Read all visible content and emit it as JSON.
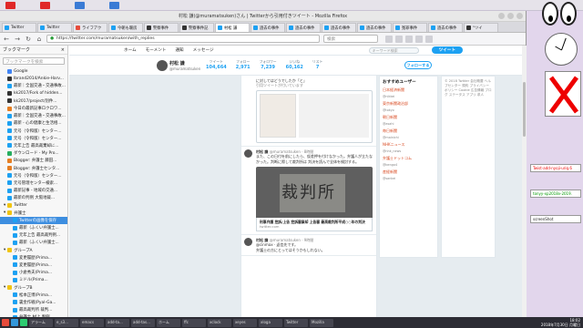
{
  "window": {
    "title": "村松 謙(@muramatsuken)さん | Twitterから引用付きツイート - Mozilla Firefox"
  },
  "tabs": [
    {
      "label": "Twitter",
      "color": "#1da1f2",
      "active": false
    },
    {
      "label": "Twitter",
      "color": "#1da1f2",
      "active": false
    },
    {
      "label": "ライフアク",
      "color": "#e74c3c",
      "active": false
    },
    {
      "label": "今朝も暖房",
      "color": "#1da1f2",
      "active": false
    },
    {
      "label": "警察事件",
      "color": "#333333",
      "active": false
    },
    {
      "label": "警察事件記",
      "color": "#333333",
      "active": false
    },
    {
      "label": "村松 謙",
      "color": "#1da1f2",
      "active": true
    },
    {
      "label": "過去の事件",
      "color": "#1da1f2",
      "active": false
    },
    {
      "label": "過去の事件",
      "color": "#1da1f2",
      "active": false
    },
    {
      "label": "過去の事件",
      "color": "#1da1f2",
      "active": false
    },
    {
      "label": "過去の事件",
      "color": "#1da1f2",
      "active": false
    },
    {
      "label": "冤罪事件",
      "color": "#1da1f2",
      "active": false
    },
    {
      "label": "過去の事件",
      "color": "#1da1f2",
      "active": false
    },
    {
      "label": "\"ツイ",
      "color": "#333333",
      "active": false
    }
  ],
  "navbar": {
    "url": "https://twitter.com/muramatsuken/with_replies",
    "search_placeholder": "検索"
  },
  "sidebar": {
    "title": "ブックマーク",
    "close": "×",
    "search_placeholder": "ブックマークを検索",
    "items": [
      {
        "label": "Google",
        "kind": "item",
        "color": "#4285f4"
      },
      {
        "label": "Ibrand2014/Ankie-Harv...",
        "kind": "item",
        "color": "#333333"
      },
      {
        "label": "最新｜全国交通・交通事故...",
        "kind": "item",
        "color": "#1da1f2"
      },
      {
        "label": "kk2017/Fork of hidden...",
        "kind": "item",
        "color": "#333333"
      },
      {
        "label": "kk2017/project/別件...",
        "kind": "item",
        "color": "#333333"
      },
      {
        "label": "今日の最新記事ロクロワ...",
        "kind": "item",
        "color": "#e67e22"
      },
      {
        "label": "最新｜全国交通・交通事故...",
        "kind": "item",
        "color": "#1da1f2"
      },
      {
        "label": "最新 - 心の健康と生活相...",
        "kind": "item",
        "color": "#1da1f2"
      },
      {
        "label": "元号（令和版）センター...",
        "kind": "item",
        "color": "#1da1f2"
      },
      {
        "label": "元号（令和版）センター...",
        "kind": "item",
        "color": "#1da1f2"
      },
      {
        "label": "元年上告 最高裁棄却に...",
        "kind": "item",
        "color": "#1da1f2"
      },
      {
        "label": "ダウンロード - My Pro...",
        "kind": "item",
        "color": "#27ae60"
      },
      {
        "label": "Blogger: 弁護士 藤田...",
        "kind": "item",
        "color": "#e67e22"
      },
      {
        "label": "Blogger: 弁護士センタ...",
        "kind": "item",
        "color": "#e67e22"
      },
      {
        "label": "元号（令和版）センター...",
        "kind": "item",
        "color": "#1da1f2"
      },
      {
        "label": "元号管理センター検索...",
        "kind": "item",
        "color": "#1da1f2"
      },
      {
        "label": "最新記事 - 地域の交通...",
        "kind": "item",
        "color": "#1da1f2"
      },
      {
        "label": "最新の判例 大阪地裁...",
        "kind": "item",
        "color": "#1da1f2"
      },
      {
        "label": "Twitter",
        "kind": "folder",
        "color": "#f1c40f"
      },
      {
        "label": "弁護士",
        "kind": "folder",
        "color": "#f1c40f"
      },
      {
        "label": "Twitterの画像を保存",
        "kind": "selected",
        "color": "#1da1f2"
      },
      {
        "label": "最新（ふくい弁護士...",
        "kind": "sub",
        "color": "#1da1f2"
      },
      {
        "label": "元年上告 最高裁判例...",
        "kind": "sub",
        "color": "#1da1f2"
      },
      {
        "label": "最新（ふくい弁護士...",
        "kind": "sub",
        "color": "#1da1f2"
      },
      {
        "label": "グループA",
        "kind": "folder",
        "color": "#f1c40f"
      },
      {
        "label": "変更履歴(Prima...",
        "kind": "sub",
        "color": "#1da1f2"
      },
      {
        "label": "変更履歴(Prima...",
        "kind": "sub",
        "color": "#1da1f2"
      },
      {
        "label": "小倉秀夫(Prima...",
        "kind": "sub",
        "color": "#1da1f2"
      },
      {
        "label": "ミドル(Prima...",
        "kind": "sub",
        "color": "#1da1f2"
      },
      {
        "label": "グループB",
        "kind": "folder",
        "color": "#f1c40f"
      },
      {
        "label": "松本正博(Prima...",
        "kind": "sub",
        "color": "#1da1f2"
      },
      {
        "label": "裏金作戦(Pyal-Ga...",
        "kind": "sub",
        "color": "#1da1f2"
      },
      {
        "label": "最高裁判所 裁判...",
        "kind": "sub",
        "color": "#1da1f2"
      },
      {
        "label": "弁護士 村上 判例...",
        "kind": "sub",
        "color": "#1da1f2"
      }
    ]
  },
  "twitter": {
    "nav": {
      "home": "ホーム",
      "moments": "モーメント",
      "notifications": "通知",
      "messages": "メッセージ",
      "search_placeholder": "キーワード検索",
      "tweet": "ツイート"
    },
    "profile": {
      "name": "村松 謙",
      "handle": "@muramatsuken",
      "stats": [
        {
          "label": "ツイート",
          "value": "104,664"
        },
        {
          "label": "フォロー",
          "value": "2,971"
        },
        {
          "label": "フォロワー",
          "value": "7,239"
        },
        {
          "label": "いいね",
          "value": "60,162"
        },
        {
          "label": "リスト",
          "value": "7"
        }
      ],
      "follow_button": "フォローする"
    },
    "tweets": [
      {
        "who": "",
        "handle": "",
        "text": "に対してはどうでしたか「と」",
        "sub": "引用ツイートが付いています"
      },
      {
        "who": "村松 謙",
        "handle": "@muramatsuken · 8時間",
        "text": "また、この日付を前にしたら、仮差押を付けなかった。弁護人が立たなかった。判断に際して裁判所は 判決を読んで全体を検討する。",
        "card_title": "裁判所 事件の処理 / 判決の言い渡し",
        "card_url": "twitter.com"
      },
      {
        "who": "",
        "handle": "",
        "kanji": "裁判所",
        "card_title": "刑事弁護 控訴/上告 控訴審棄却 上告審 最高裁判所平成○○年の判決",
        "card_url": "twitter.com"
      },
      {
        "who": "村松 謙",
        "handle": "@muramatsuken · 9時間",
        "text": "@cinmax · 返信先です。",
        "sub": "弁護士の方にとってはそうかもしれない。"
      }
    ],
    "right": {
      "title": "おすすめユーザー",
      "items": [
        {
          "name": "日本経済新聞",
          "sub": "@nikkei"
        },
        {
          "name": "東京新聞政治部",
          "sub": "@tokyo"
        },
        {
          "name": "朝日新聞",
          "sub": "@asahi"
        },
        {
          "name": "毎日新聞",
          "sub": "@mainichi"
        },
        {
          "name": "NHKニュース",
          "sub": "@nhk_news"
        },
        {
          "name": "弁護士ドットコム",
          "sub": "@bengo4"
        },
        {
          "name": "産経新聞",
          "sub": "@sankei"
        }
      ]
    },
    "right2": {
      "links": "© 2018 Twitter 会社概要 ヘルプセンター 規約 プライバシーポリシー Cookie 広告情報 ブログ ステータス アプリ 求人"
    }
  },
  "desktop": {
    "terminals": [
      "Twist-add-nyoji-uriq.6",
      "tonyy-xp2018v-2019.",
      "screenShot"
    ],
    "taskbar": {
      "tasks": [
        "アラーム",
        "e_s3...",
        "emacs",
        "add-ta...",
        "add-tas...",
        "ホーム",
        "ffc",
        "xclock",
        "xeyes",
        "xloga",
        "Twitter",
        "Mozilla"
      ],
      "time": "18:02",
      "date": "2018年7月30日 月曜日"
    }
  }
}
